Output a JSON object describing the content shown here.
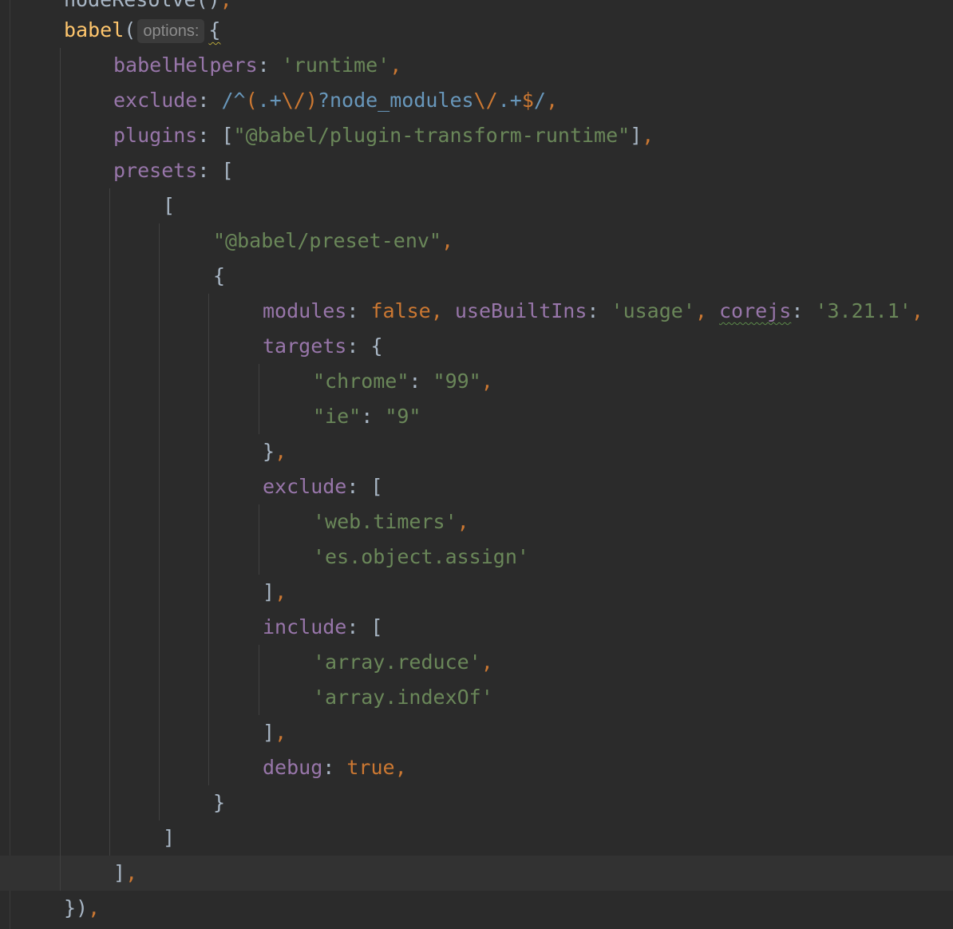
{
  "editor": {
    "language": "javascript",
    "theme": "darcula",
    "colors": {
      "background": "#2b2b2b",
      "property": "#9876aa",
      "string": "#6a8759",
      "keyword": "#cc7832",
      "punctuation": "#a9b7c6",
      "regex": "#6897bb",
      "parameter_hint": "#8c8c8c",
      "current_line": "#323232"
    },
    "parameter_hint": "options:",
    "lines": [
      {
        "tokens": [
          {
            "t": "nodeResolve()",
            "c": "k-punc"
          },
          {
            "t": ",",
            "c": "k-kw"
          }
        ]
      },
      {
        "tokens": [
          {
            "t": "babel",
            "c": "k-fn"
          },
          {
            "t": "(",
            "c": "k-punc"
          },
          {
            "hint": true
          },
          {
            "t": "{",
            "c": "k-punc squiggle-warn"
          }
        ]
      },
      {
        "tokens": [
          {
            "t": "babelHelpers",
            "c": "k-prop"
          },
          {
            "t": ": ",
            "c": "k-punc"
          },
          {
            "t": "'runtime'",
            "c": "k-str"
          },
          {
            "t": ",",
            "c": "k-kw"
          }
        ]
      },
      {
        "tokens": [
          {
            "t": "exclude",
            "c": "k-prop"
          },
          {
            "t": ": ",
            "c": "k-punc"
          },
          {
            "t": "/^",
            "c": "k-rx"
          },
          {
            "t": "(",
            "c": "k-rxm"
          },
          {
            "t": ".+",
            "c": "k-rx"
          },
          {
            "t": "\\/",
            "c": "k-rxm"
          },
          {
            "t": ")",
            "c": "k-rxm"
          },
          {
            "t": "?node_modules",
            "c": "k-rx"
          },
          {
            "t": "\\/",
            "c": "k-rxm"
          },
          {
            "t": ".+",
            "c": "k-rx"
          },
          {
            "t": "$",
            "c": "k-rxm"
          },
          {
            "t": "/",
            "c": "k-rx"
          },
          {
            "t": ",",
            "c": "k-kw"
          }
        ]
      },
      {
        "tokens": [
          {
            "t": "plugins",
            "c": "k-prop"
          },
          {
            "t": ": [",
            "c": "k-punc"
          },
          {
            "t": "\"@babel/plugin-transform-runtime\"",
            "c": "k-str"
          },
          {
            "t": "]",
            "c": "k-punc"
          },
          {
            "t": ",",
            "c": "k-kw"
          }
        ]
      },
      {
        "tokens": [
          {
            "t": "presets",
            "c": "k-prop"
          },
          {
            "t": ": [",
            "c": "k-punc"
          }
        ]
      },
      {
        "tokens": [
          {
            "t": "[",
            "c": "k-punc"
          }
        ]
      },
      {
        "tokens": [
          {
            "t": "\"@babel/preset-env\"",
            "c": "k-str"
          },
          {
            "t": ",",
            "c": "k-kw"
          }
        ]
      },
      {
        "tokens": [
          {
            "t": "{",
            "c": "k-punc"
          }
        ]
      },
      {
        "tokens": [
          {
            "t": "modules",
            "c": "k-prop"
          },
          {
            "t": ": ",
            "c": "k-punc"
          },
          {
            "t": "false",
            "c": "k-kw"
          },
          {
            "t": ", ",
            "c": "k-kw"
          },
          {
            "t": "useBuiltIns",
            "c": "k-prop"
          },
          {
            "t": ": ",
            "c": "k-punc"
          },
          {
            "t": "'usage'",
            "c": "k-str"
          },
          {
            "t": ", ",
            "c": "k-kw"
          },
          {
            "t": "corejs",
            "c": "k-prop squiggle"
          },
          {
            "t": ": ",
            "c": "k-punc"
          },
          {
            "t": "'3.21.1'",
            "c": "k-str"
          },
          {
            "t": ",",
            "c": "k-kw"
          }
        ]
      },
      {
        "tokens": [
          {
            "t": "targets",
            "c": "k-prop"
          },
          {
            "t": ": {",
            "c": "k-punc"
          }
        ]
      },
      {
        "tokens": [
          {
            "t": "\"chrome\"",
            "c": "k-str"
          },
          {
            "t": ": ",
            "c": "k-punc"
          },
          {
            "t": "\"99\"",
            "c": "k-str"
          },
          {
            "t": ",",
            "c": "k-kw"
          }
        ]
      },
      {
        "tokens": [
          {
            "t": "\"ie\"",
            "c": "k-str"
          },
          {
            "t": ": ",
            "c": "k-punc"
          },
          {
            "t": "\"9\"",
            "c": "k-str"
          }
        ]
      },
      {
        "tokens": [
          {
            "t": "}",
            "c": "k-punc"
          },
          {
            "t": ",",
            "c": "k-kw"
          }
        ]
      },
      {
        "tokens": [
          {
            "t": "exclude",
            "c": "k-prop"
          },
          {
            "t": ": [",
            "c": "k-punc"
          }
        ]
      },
      {
        "tokens": [
          {
            "t": "'web.timers'",
            "c": "k-str"
          },
          {
            "t": ",",
            "c": "k-kw"
          }
        ]
      },
      {
        "tokens": [
          {
            "t": "'es.object.assign'",
            "c": "k-str"
          }
        ]
      },
      {
        "tokens": [
          {
            "t": "]",
            "c": "k-punc"
          },
          {
            "t": ",",
            "c": "k-kw"
          }
        ]
      },
      {
        "tokens": [
          {
            "t": "include",
            "c": "k-prop"
          },
          {
            "t": ": [",
            "c": "k-punc"
          }
        ]
      },
      {
        "tokens": [
          {
            "t": "'array.reduce'",
            "c": "k-str"
          },
          {
            "t": ",",
            "c": "k-kw"
          }
        ]
      },
      {
        "tokens": [
          {
            "t": "'array.indexOf'",
            "c": "k-str"
          }
        ]
      },
      {
        "tokens": [
          {
            "t": "]",
            "c": "k-punc"
          },
          {
            "t": ",",
            "c": "k-kw"
          }
        ]
      },
      {
        "tokens": [
          {
            "t": "debug",
            "c": "k-prop"
          },
          {
            "t": ": ",
            "c": "k-punc"
          },
          {
            "t": "true",
            "c": "k-kw"
          },
          {
            "t": ",",
            "c": "k-kw"
          }
        ]
      },
      {
        "tokens": [
          {
            "t": "}",
            "c": "k-punc"
          }
        ]
      },
      {
        "tokens": [
          {
            "t": "]",
            "c": "k-punc"
          }
        ]
      },
      {
        "tokens": [
          {
            "t": "]",
            "c": "k-punc"
          },
          {
            "t": ",",
            "c": "k-kw"
          }
        ]
      },
      {
        "tokens": [
          {
            "t": "})",
            "c": "k-punc"
          },
          {
            "t": ",",
            "c": "k-kw"
          }
        ]
      }
    ]
  }
}
